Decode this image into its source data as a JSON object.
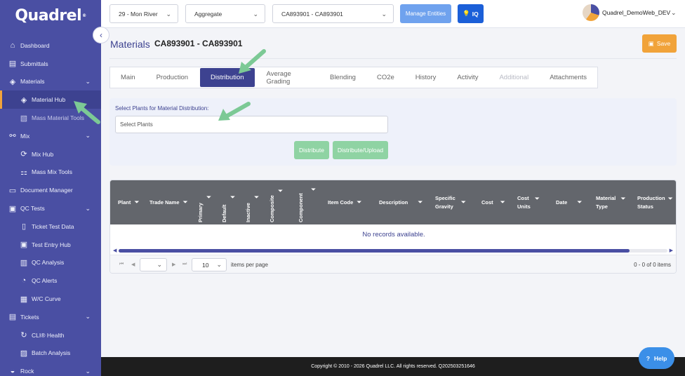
{
  "brand": {
    "logo_text": "Quadrel",
    "logo_mark": "®",
    "accent": "#4a4fa3",
    "orange": "#f1a33a"
  },
  "sidebar": {
    "items": [
      {
        "label": "Dashboard",
        "icon": "home-icon"
      },
      {
        "label": "Submittals",
        "icon": "submittals-icon"
      },
      {
        "label": "Materials",
        "icon": "layers-icon"
      },
      {
        "label": "Material Hub",
        "icon": "layers-icon"
      },
      {
        "label": "Mass Material Tools",
        "icon": "tools-icon"
      },
      {
        "label": "Mix",
        "icon": "mix-icon"
      },
      {
        "label": "Mix Hub",
        "icon": "mix-hub-icon"
      },
      {
        "label": "Mass Mix Tools",
        "icon": "mass-mix-icon"
      },
      {
        "label": "Document Manager",
        "icon": "folder-icon"
      },
      {
        "label": "QC Tests",
        "icon": "clipboard-icon"
      },
      {
        "label": "Ticket Test Data",
        "icon": "document-icon"
      },
      {
        "label": "Test Entry Hub",
        "icon": "clipboard-icon"
      },
      {
        "label": "QC Analysis",
        "icon": "bar-chart-icon"
      },
      {
        "label": "QC Alerts",
        "icon": "alert-icon"
      },
      {
        "label": "W/C Curve",
        "icon": "curve-icon"
      },
      {
        "label": "Tickets",
        "icon": "ticket-icon"
      },
      {
        "label": "CLI® Health",
        "icon": "refresh-icon"
      },
      {
        "label": "Batch Analysis",
        "icon": "batch-icon"
      },
      {
        "label": "Rock",
        "icon": "rock-icon"
      }
    ]
  },
  "topbar": {
    "plant": "29 - Mon River",
    "material_type": "Aggregate",
    "material": "CA893901 - CA893901",
    "manage_entities": "Manage Entities",
    "iq": "IQ",
    "username": "Quadrel_DemoWeb_DEV"
  },
  "header": {
    "title": "Materials",
    "subtitle": "CA893901 - CA893901",
    "save": "Save"
  },
  "tabs": [
    "Main",
    "Production",
    "Distribution",
    "Average Grading",
    "Blending",
    "CO2e",
    "History",
    "Activity",
    "Additional",
    "Attachments"
  ],
  "distribution": {
    "label": "Select Plants for Material Distribution:",
    "placeholder": "Select Plants",
    "distribute": "Distribute",
    "distribute_upload": "Distribute/Upload"
  },
  "grid": {
    "columns": {
      "plant": "Plant",
      "trade_name": "Trade Name",
      "primary": "Primary",
      "default": "Default",
      "inactive": "Inactive",
      "composite": "Composite",
      "component": "Component",
      "item_code": "Item Code",
      "description": "Description",
      "specific_gravity_1": "Specific",
      "specific_gravity_2": "Gravity",
      "cost": "Cost",
      "cost_units_1": "Cost",
      "cost_units_2": "Units",
      "date": "Date",
      "material_type_1": "Material",
      "material_type_2": "Type",
      "production_status_1": "Production",
      "production_status_2": "Status"
    },
    "empty": "No records available.",
    "page_size": "10",
    "items_per_page": "items per page",
    "range": "0 - 0 of 0 items"
  },
  "footer": {
    "copyright": "Copyright © 2010 - 2026 Quadrel LLC. All rights reserved. Q202503251646"
  },
  "help": {
    "label": "Help"
  }
}
